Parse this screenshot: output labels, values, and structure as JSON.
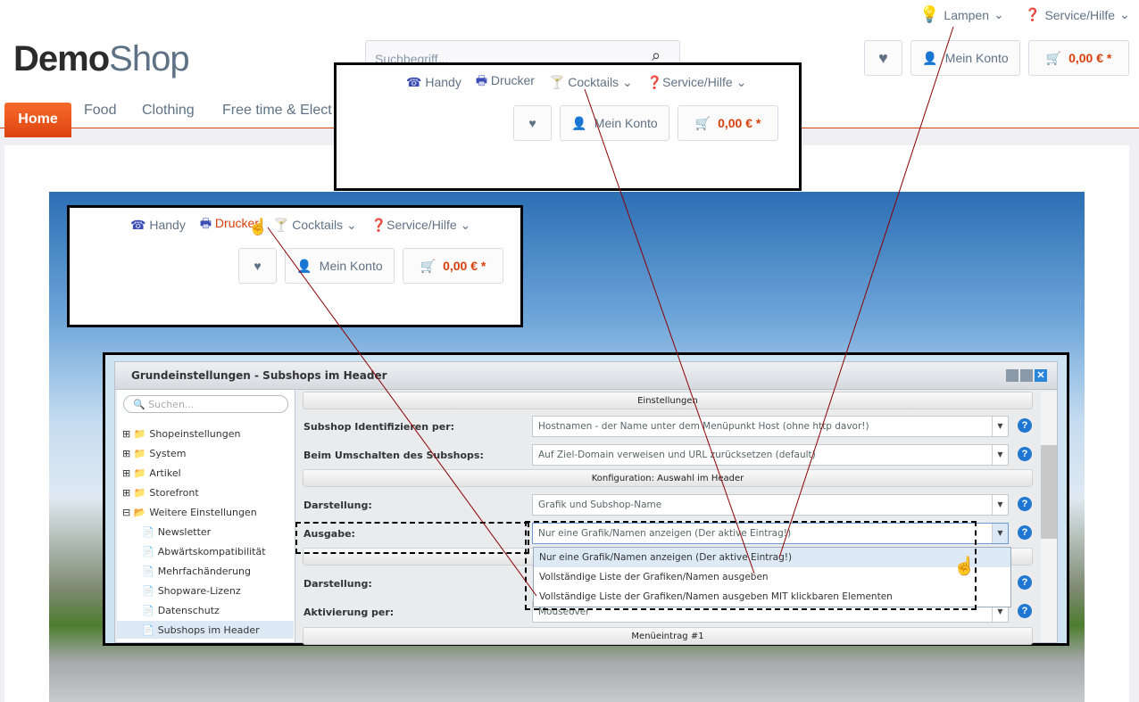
{
  "topbar": {
    "lampen": "Lampen",
    "service": "Service/Hilfe"
  },
  "logo": {
    "bold": "Demo",
    "light": "Shop"
  },
  "search": {
    "placeholder": "Suchbegriff..."
  },
  "account": {
    "label": "Mein Konto",
    "cart": "0,00 € *"
  },
  "nav": [
    "Home",
    "Food",
    "Clothing",
    "Free time & Elect"
  ],
  "callout1": {
    "items": [
      "Handy",
      "Drucker",
      "Cocktails",
      "Service/Hilfe"
    ],
    "account": "Mein Konto",
    "cart": "0,00 € *"
  },
  "callout2": {
    "items": [
      "Handy",
      "Drucker",
      "Cocktails",
      "Service/Hilfe"
    ],
    "account": "Mein Konto",
    "cart": "0,00 € *",
    "hovered": "Drucker"
  },
  "config": {
    "title": "Grundeinstellungen - Subshops im Header",
    "search_placeholder": "Suchen...",
    "tree": [
      "Shopeinstellungen",
      "System",
      "Artikel",
      "Storefront",
      "Weitere Einstellungen",
      "Newsletter",
      "Abwärtskompatibilität",
      "Mehrfachänderung",
      "Shopware-Lizenz",
      "Datenschutz",
      "Subshops im Header"
    ],
    "sections": [
      "Einstellungen",
      "Konfiguration: Auswahl im Header",
      "Menüeintrag #1"
    ],
    "fields": [
      {
        "label": "Subshop Identifizieren per:",
        "value": "Hostnamen - der Name unter dem Menüpunkt Host (ohne http davor!)"
      },
      {
        "label": "Beim Umschalten des Subshops:",
        "value": "Auf Ziel-Domain verweisen und URL zurücksetzen (default)"
      },
      {
        "label": "Darstellung:",
        "value": "Grafik und Subshop-Name"
      },
      {
        "label": "Ausgabe:",
        "value": "Nur eine Grafik/Namen anzeigen (Der aktive Eintrag!)"
      },
      {
        "label": "Darstellung:",
        "value": ""
      },
      {
        "label": "Aktivierung per:",
        "value": "Mouseover"
      }
    ],
    "dropdown_options": [
      "Nur eine Grafik/Namen anzeigen (Der aktive Eintrag!)",
      "Vollständige Liste der Grafiken/Namen ausgeben",
      "Vollständige Liste der Grafiken/Namen ausgeben MIT klickbaren Elementen"
    ]
  },
  "colors": {
    "accent": "#d9400b",
    "icon": "#3b4db5",
    "arrow": "#8b0000"
  }
}
